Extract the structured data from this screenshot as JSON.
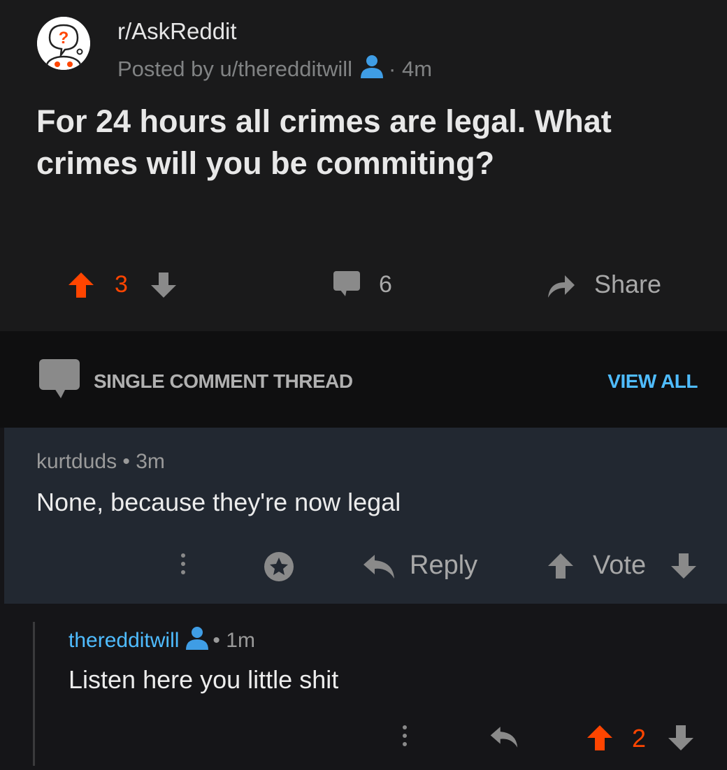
{
  "post": {
    "subreddit": "r/AskReddit",
    "posted_by": "Posted by u/theredditwill",
    "time": "· 4m",
    "title": "For 24 hours all crimes are legal. What crimes will you be commiting?",
    "score": "3",
    "comment_count": "6",
    "share_label": "Share",
    "colors": {
      "upvoted": "#ff4500",
      "link": "#4fbcff",
      "user_icon": "#3f9de5"
    }
  },
  "thread": {
    "label": "SINGLE COMMENT THREAD",
    "view_all": "VIEW ALL"
  },
  "comment1": {
    "author_meta": "kurtduds • 3m",
    "body": "None, because they're now legal",
    "reply_label": "Reply",
    "vote_label": "Vote"
  },
  "comment2": {
    "author": "theredditwill",
    "time": "• 1m",
    "body": "Listen here you little shit",
    "score": "2"
  },
  "icons": [
    "askreddit-avatar-icon",
    "user-icon",
    "upvote-arrow-icon",
    "downvote-arrow-icon",
    "comment-bubble-icon",
    "share-arrow-icon",
    "ellipsis-icon",
    "award-icon",
    "reply-arrow-icon"
  ]
}
